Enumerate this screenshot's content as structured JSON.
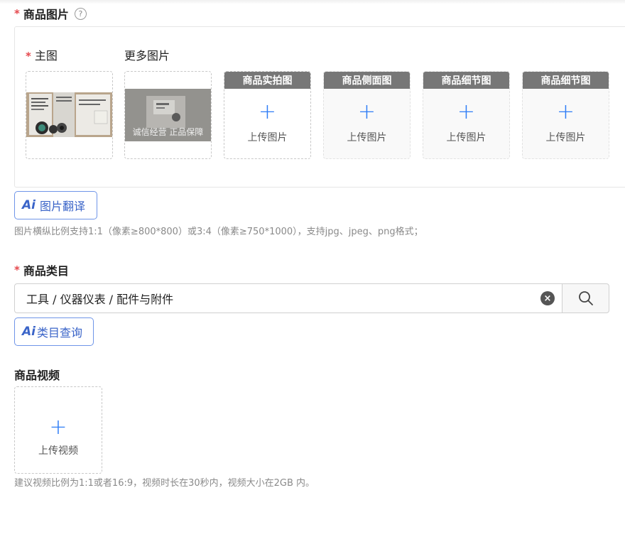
{
  "image_section": {
    "label": "商品图片",
    "required_mark": "*",
    "help_icon": "?",
    "main_label": "主图",
    "more_label": "更多图片",
    "watermark": "诚信经营 正品保障",
    "upload_slots": [
      {
        "title": "商品实拍图",
        "plus": "+",
        "text": "上传图片"
      },
      {
        "title": "商品侧面图",
        "plus": "+",
        "text": "上传图片"
      },
      {
        "title": "商品细节图",
        "plus": "+",
        "text": "上传图片"
      },
      {
        "title": "商品细节图",
        "plus": "+",
        "text": "上传图片"
      }
    ],
    "ai_button": {
      "logo": "Ai",
      "label": "图片翻译"
    },
    "hint": "图片横纵比例支持1:1（像素≥800*800）或3:4（像素≥750*1000），支持jpg、jpeg、png格式；"
  },
  "category_section": {
    "label": "商品类目",
    "required_mark": "*",
    "value": "工具 / 仪器仪表 / 配件与附件",
    "clear_icon": "×",
    "ai_button": {
      "logo": "Ai",
      "label": "类目查询"
    }
  },
  "video_section": {
    "label": "商品视频",
    "plus": "+",
    "upload_text": "上传视频",
    "hint": "建议视频比例为1:1或者16:9，视频时长在30秒内，视频大小在2GB 内。"
  },
  "colors": {
    "accent": "#2f7df6",
    "required": "#e5484d",
    "ai_blue": "#3a64c8"
  }
}
